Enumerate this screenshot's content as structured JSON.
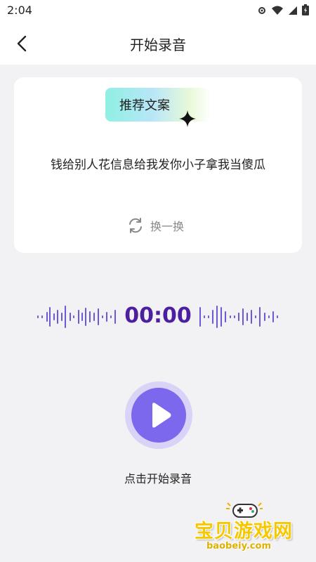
{
  "status_bar": {
    "time": "2:04",
    "icons": [
      "settings-icon",
      "wifi-icon",
      "signal-icon",
      "battery-icon"
    ]
  },
  "header": {
    "title": "开始录音",
    "back_icon": "chevron-left-icon"
  },
  "card": {
    "tag_label": "推荐文案",
    "text": "钱给别人花信息给我发你小子拿我当傻瓜",
    "refresh_label": "换一换"
  },
  "recorder": {
    "timer": "00:00",
    "start_label": "点击开始录音"
  },
  "watermark": {
    "title": "宝贝游戏网",
    "url": "baobeiy.com"
  },
  "colors": {
    "accent": "#7c68ec",
    "timer": "#4b1fa0",
    "wave": "#6a5ad6"
  }
}
